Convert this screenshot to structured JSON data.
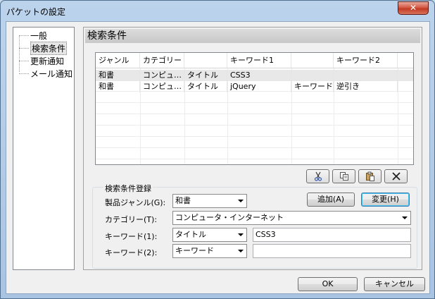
{
  "window": {
    "title": "パケットの設定",
    "close_glyph": "✕"
  },
  "nav": {
    "items": [
      {
        "label": "一般",
        "selected": false
      },
      {
        "label": "検索条件",
        "selected": true
      },
      {
        "label": "更新通知",
        "selected": false
      },
      {
        "label": "メール通知",
        "selected": false
      }
    ]
  },
  "panel": {
    "title": "検索条件"
  },
  "table": {
    "headers": [
      "ジャンル",
      "カテゴリー",
      "",
      "キーワード1",
      "",
      "キーワード2"
    ],
    "rows": [
      [
        "和書",
        "コンピュ…",
        "タイトル",
        "CSS3",
        "",
        ""
      ],
      [
        "和書",
        "コンピュ…",
        "タイトル",
        "jQuery",
        "キーワード",
        "逆引き"
      ]
    ]
  },
  "toolbar": {
    "cut_icon": "scissors-icon",
    "copy_icon": "copy-icon",
    "paste_icon": "paste-icon",
    "delete_icon": "delete-x-icon"
  },
  "form": {
    "group_title": "検索条件登録",
    "genre_label": "製品ジャンル(G):",
    "genre_value": "和書",
    "category_label": "カテゴリー(T):",
    "category_value": "コンピュータ・インターネット",
    "keyword1_label": "キーワード(1):",
    "keyword1_type": "タイトル",
    "keyword1_value": "CSS3",
    "keyword2_label": "キーワード(2):",
    "keyword2_type": "キーワード",
    "keyword2_value": "",
    "add_label": "追加(A)",
    "change_label": "変更(H)"
  },
  "footer": {
    "ok_label": "OK",
    "cancel_label": "キャンセル"
  }
}
